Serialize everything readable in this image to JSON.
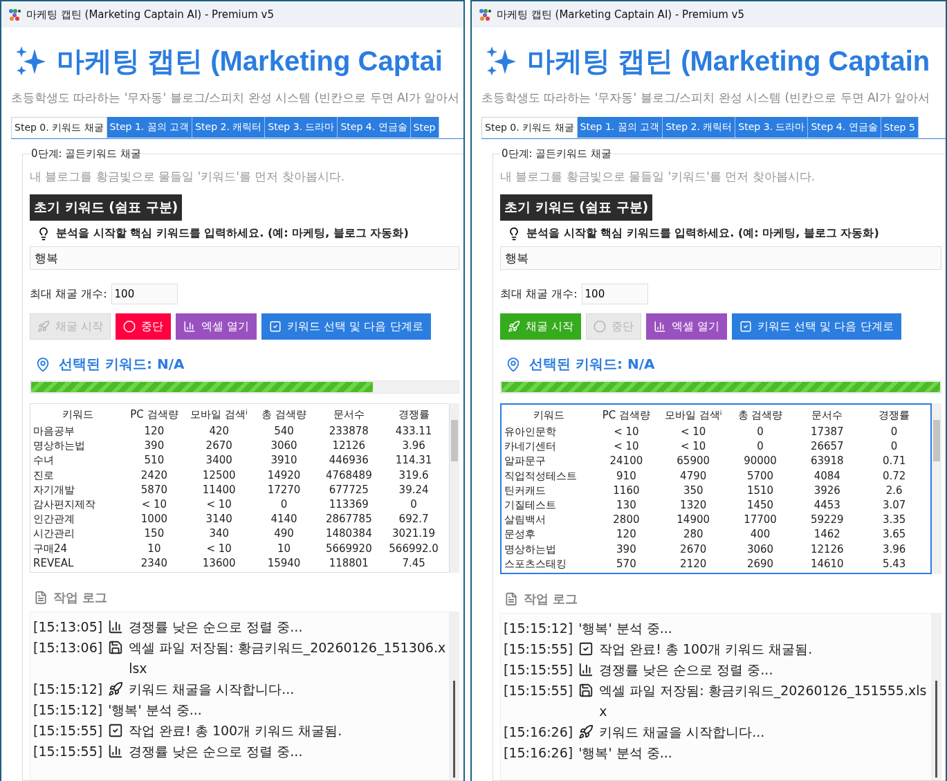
{
  "windows": [
    {
      "title": "마케팅 캡틴 (Marketing Captain AI) - Premium v5",
      "heading": "마케팅 캡틴 (Marketing Captai",
      "subtitle": "초등학생도 따라하는 '무자동' 블로그/스피치 완성 시스템 (빈칸으로 두면 AI가 알아서",
      "tabs": [
        {
          "label": "Step 0. 키워드 채굴",
          "selected": true
        },
        {
          "label": "Step 1. 꿈의 고객",
          "selected": false
        },
        {
          "label": "Step 2. 캐릭터",
          "selected": false
        },
        {
          "label": "Step 3. 드라마",
          "selected": false
        },
        {
          "label": "Step 4. 연금술",
          "selected": false
        },
        {
          "label": "Step",
          "selected": false
        }
      ],
      "section": {
        "legend": "0단계: 골든키워드 채굴",
        "description": "내 블로그를 황금빛으로 물들일 '키워드'를 먼저 찾아봅시다.",
        "input_label": "초기 키워드 (쉼표 구분)",
        "hint": "분석을 시작할 핵심 키워드를 입력하세요. (예: 마케팅, 블로그 자동화)",
        "input_value": "행복",
        "max_label": "최대 채굴 개수:",
        "max_value": "100"
      },
      "buttons": [
        {
          "kind": "start",
          "label": "채굴 시작",
          "disabled": true
        },
        {
          "kind": "stop",
          "label": "중단",
          "disabled": false
        },
        {
          "kind": "excel",
          "label": "엑셀 열기",
          "disabled": false
        },
        {
          "kind": "next",
          "label": "키워드 선택 및 다음 단계로",
          "disabled": false
        }
      ],
      "selected_keyword": "선택된 키워드: N/A",
      "progress": {
        "level": 0.8
      },
      "table": {
        "focused": false,
        "columns": [
          "키워드",
          "PC 검색량",
          "모바일 검색ⁱ",
          "총 검색량",
          "문서수",
          "경쟁률"
        ],
        "rows": [
          [
            "마음공부",
            "120",
            "420",
            "540",
            "233878",
            "433.11"
          ],
          [
            "명상하는법",
            "390",
            "2670",
            "3060",
            "12126",
            "3.96"
          ],
          [
            "수녀",
            "510",
            "3400",
            "3910",
            "446936",
            "114.31"
          ],
          [
            "진로",
            "2420",
            "12500",
            "14920",
            "4768489",
            "319.6"
          ],
          [
            "자기개발",
            "5870",
            "11400",
            "17270",
            "677725",
            "39.24"
          ],
          [
            "감사편지제작",
            "< 10",
            "< 10",
            "0",
            "113369",
            "0"
          ],
          [
            "인간관계",
            "1000",
            "3140",
            "4140",
            "2867785",
            "692.7"
          ],
          [
            "시간관리",
            "150",
            "340",
            "490",
            "1480384",
            "3021.19"
          ],
          [
            "구매24",
            "10",
            "< 10",
            "10",
            "5669920",
            "566992.0"
          ],
          [
            "REVEAL",
            "2340",
            "13600",
            "15940",
            "118801",
            "7.45"
          ]
        ]
      },
      "log": {
        "title": "작업 로그",
        "entries": [
          {
            "time": "[15:13:05]",
            "kind": "chart",
            "text": "경쟁률 낮은 순으로 정렬 중..."
          },
          {
            "time": "[15:13:06]",
            "kind": "save",
            "text": "엑셀 파일 저장됨: 황금키워드_20260126_151306.xlsx"
          },
          {
            "time": "[15:15:12]",
            "kind": "rocket",
            "text": "키워드 채굴을 시작합니다..."
          },
          {
            "time": "[15:15:12]",
            "kind": "plain",
            "text": "'행복' 분석 중..."
          },
          {
            "time": "[15:15:55]",
            "kind": "check",
            "text": "작업 완료! 총 100개 키워드 채굴됨."
          },
          {
            "time": "[15:15:55]",
            "kind": "chart",
            "text": "경쟁률 낮은 순으로 정렬 중..."
          }
        ]
      }
    },
    {
      "title": "마케팅 캡틴 (Marketing Captain AI) - Premium v5",
      "heading": "마케팅 캡틴 (Marketing Captain",
      "subtitle": "초등학생도 따라하는 '무자동' 블로그/스피치 완성 시스템 (빈칸으로 두면 AI가 알아서",
      "tabs": [
        {
          "label": "Step 0. 키워드 채굴",
          "selected": true
        },
        {
          "label": "Step 1. 꿈의 고객",
          "selected": false
        },
        {
          "label": "Step 2. 캐릭터",
          "selected": false
        },
        {
          "label": "Step 3. 드라마",
          "selected": false
        },
        {
          "label": "Step 4. 연금술",
          "selected": false
        },
        {
          "label": "Step 5",
          "selected": false
        }
      ],
      "section": {
        "legend": "0단계: 골든키워드 채굴",
        "description": "내 블로그를 황금빛으로 물들일 '키워드'를 먼저 찾아봅시다.",
        "input_label": "초기 키워드 (쉼표 구분)",
        "hint": "분석을 시작할 핵심 키워드를 입력하세요. (예: 마케팅, 블로그 자동화)",
        "input_value": "행복",
        "max_label": "최대 채굴 개수:",
        "max_value": "100"
      },
      "buttons": [
        {
          "kind": "start",
          "label": "채굴 시작",
          "disabled": false
        },
        {
          "kind": "stop",
          "label": "중단",
          "disabled": true
        },
        {
          "kind": "excel",
          "label": "엑셀 열기",
          "disabled": false
        },
        {
          "kind": "next",
          "label": "키워드 선택 및 다음 단계로",
          "disabled": false
        }
      ],
      "selected_keyword": "선택된 키워드: N/A",
      "progress": {
        "level": 1
      },
      "table": {
        "focused": true,
        "columns": [
          "키워드",
          "PC 검색량",
          "모바일 검색ⁱ",
          "총 검색량",
          "문서수",
          "경쟁률"
        ],
        "rows": [
          [
            "유아인문학",
            "< 10",
            "< 10",
            "0",
            "17387",
            "0"
          ],
          [
            "카네기센터",
            "< 10",
            "< 10",
            "0",
            "26657",
            "0"
          ],
          [
            "알파문구",
            "24100",
            "65900",
            "90000",
            "63918",
            "0.71"
          ],
          [
            "직업적성테스트",
            "910",
            "4790",
            "5700",
            "4084",
            "0.72"
          ],
          [
            "틴커캐드",
            "1160",
            "350",
            "1510",
            "3926",
            "2.6"
          ],
          [
            "기질테스트",
            "130",
            "1320",
            "1450",
            "4453",
            "3.07"
          ],
          [
            "살림백서",
            "2800",
            "14900",
            "17700",
            "59229",
            "3.35"
          ],
          [
            "문성후",
            "120",
            "280",
            "400",
            "1462",
            "3.65"
          ],
          [
            "명상하는법",
            "390",
            "2670",
            "3060",
            "12126",
            "3.96"
          ],
          [
            "스포츠스태킹",
            "570",
            "2120",
            "2690",
            "14610",
            "5.43"
          ]
        ]
      },
      "log": {
        "title": "작업 로그",
        "entries": [
          {
            "time": "[15:15:12]",
            "kind": "plain",
            "text": "'행복' 분석 중..."
          },
          {
            "time": "[15:15:55]",
            "kind": "check",
            "text": "작업 완료! 총 100개 키워드 채굴됨."
          },
          {
            "time": "[15:15:55]",
            "kind": "chart",
            "text": "경쟁률 낮은 순으로 정렬 중..."
          },
          {
            "time": "[15:15:55]",
            "kind": "save",
            "text": "엑셀 파일 저장됨: 황금키워드_20260126_151555.xlsx"
          },
          {
            "time": "[15:16:26]",
            "kind": "rocket",
            "text": "키워드 채굴을 시작합니다..."
          },
          {
            "time": "[15:16:26]",
            "kind": "plain",
            "text": "'행복' 분석 중..."
          }
        ]
      }
    }
  ]
}
